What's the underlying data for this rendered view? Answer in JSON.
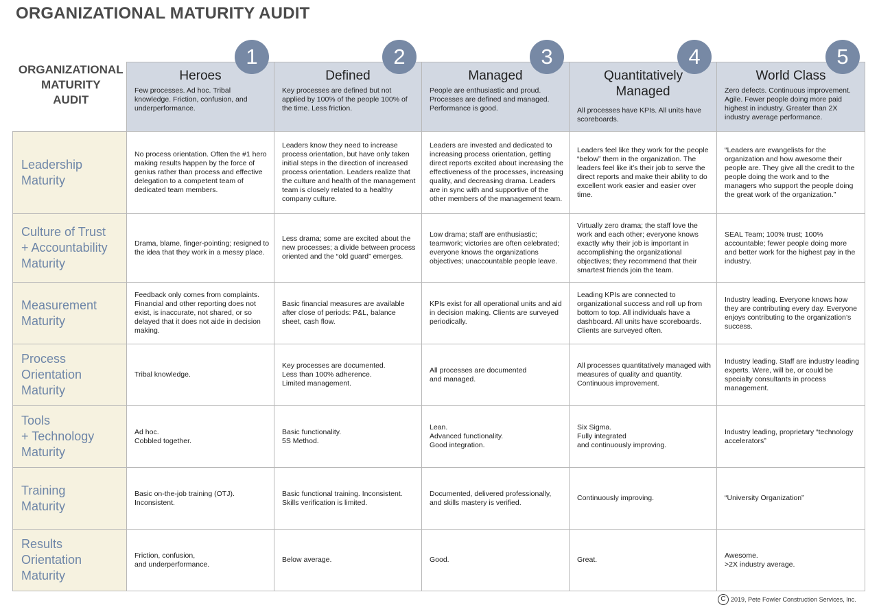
{
  "title": "ORGANIZATIONAL MATURITY AUDIT",
  "corner_label": [
    "ORGANIZATIONAL",
    "MATURITY",
    "AUDIT"
  ],
  "accent_colors": {
    "badge": "#7789a5",
    "header_fill": "#d2d8e2",
    "row_header_fill": "#f6f2e0",
    "row_header_text": "#6e86a8"
  },
  "levels": [
    {
      "number": "1",
      "name": "Heroes",
      "description": "Few processes. Ad hoc. Tribal knowledge. Friction, confusion, and underperformance."
    },
    {
      "number": "2",
      "name": "Defined",
      "description": "Key processes are defined but not applied by 100% of the people 100% of the time. Less friction."
    },
    {
      "number": "3",
      "name": "Managed",
      "description": "People are enthusiastic and proud. Processes are defined and managed. Performance is good."
    },
    {
      "number": "4",
      "name": "Quantitatively Managed",
      "description": "All processes have KPIs. All units have scoreboards."
    },
    {
      "number": "5",
      "name": "World Class",
      "description": "Zero defects. Continuous improvement. Agile. Fewer people doing more paid highest in industry. Greater than 2X industry average performance."
    }
  ],
  "rows": [
    {
      "label": [
        "Leadership",
        "Maturity"
      ],
      "cells": [
        "No process orientation. Often the #1 hero making results happen by the force of genius rather than process and effective delegation to a competent team of dedicated team members.",
        "Leaders know they need to increase process orientation, but have only taken initial steps in the direction of increased process orientation. Leaders realize that the culture and health of the management team is closely related to a healthy company culture.",
        "Leaders are invested and dedicated to increasing process orientation, getting direct reports excited about increasing the effectiveness of the processes, increasing quality, and decreasing drama. Leaders are in sync with and supportive of the other members of the management team.",
        "Leaders feel like they work for the people “below” them in the organization. The leaders feel like it’s their job to serve the direct reports and make their ability to do excellent work easier and easier over time.",
        "“Leaders are evangelists for the organization and how awesome their people are. They give all the credit to the people doing the work and to the managers who support the people doing the great work of the organization.”"
      ]
    },
    {
      "label": [
        "Culture of Trust",
        "+ Accountability",
        "Maturity"
      ],
      "cells": [
        "Drama, blame, finger-pointing; resigned to the idea that they work in a messy place.",
        "Less drama; some are excited about the new processes; a divide between process oriented and the “old guard” emerges.",
        "Low drama; staff are enthusiastic; teamwork; victories are often celebrated; everyone knows the organizations objectives; unaccountable people leave.",
        "Virtually zero drama; the staff love the work and each other; everyone knows exactly why their job is important in accomplishing the organizational objectives; they recommend that their smartest friends join the team.",
        "SEAL Team; 100% trust; 100% accountable; fewer people doing more and better work for the highest pay in the industry."
      ]
    },
    {
      "label": [
        "Measurement",
        "Maturity"
      ],
      "cells": [
        "Feedback only comes from complaints. Financial and other reporting does not exist, is inaccurate, not shared, or so delayed that it does not aide in decision making.",
        "Basic financial measures are available after close of periods: P&L, balance sheet, cash flow.",
        "KPIs exist for all operational units and aid in decision making. Clients are surveyed periodically.",
        "Leading KPIs are connected to organizational success and roll up from bottom to top. All individuals have a dashboard. All units have scoreboards. Clients are surveyed often.",
        "Industry leading. Everyone knows how they are contributing every day. Everyone enjoys contributing to the organization’s success."
      ]
    },
    {
      "label": [
        "Process",
        "Orientation",
        "Maturity"
      ],
      "cells": [
        "Tribal knowledge.",
        "Key processes are documented.\nLess than 100% adherence.\nLimited management.",
        "All processes are documented\nand managed.",
        "All processes quantitatively managed with measures of quality and quantity.\nContinuous improvement.",
        "Industry leading. Staff are industry leading experts. Were, will be, or could be specialty consultants in process management."
      ]
    },
    {
      "label": [
        "Tools",
        "+ Technology",
        "Maturity"
      ],
      "cells": [
        "Ad hoc.\nCobbled together.",
        "Basic functionality.\n5S Method.",
        "Lean.\nAdvanced functionality.\nGood integration.",
        "Six Sigma.\nFully integrated\nand continuously improving.",
        "Industry leading, proprietary “technology accelerators”"
      ]
    },
    {
      "label": [
        "Training",
        "Maturity"
      ],
      "cells": [
        "Basic on-the-job training (OTJ).\nInconsistent.",
        "Basic functional training. Inconsistent.\nSkills verification is limited.",
        "Documented, delivered professionally, and skills mastery is verified.",
        "Continuously improving.",
        "“University Organization”"
      ]
    },
    {
      "label": [
        "Results",
        "Orientation",
        "Maturity"
      ],
      "cells": [
        "Friction, confusion,\nand underperformance.",
        "Below average.",
        "Good.",
        "Great.",
        "Awesome.\n>2X industry average."
      ]
    }
  ],
  "footer": {
    "copyright_symbol": "C",
    "text": "2019, Pete Fowler Construction Services, Inc."
  }
}
